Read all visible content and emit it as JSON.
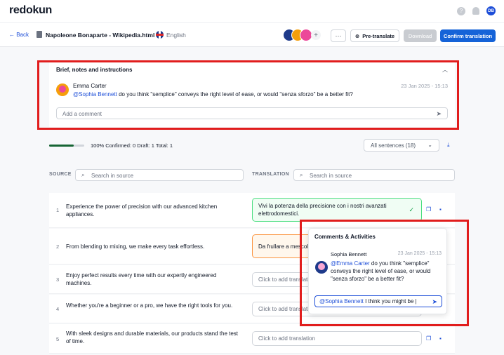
{
  "app": {
    "logo": "redokun",
    "user_initials": "DB",
    "help_glyph": "?"
  },
  "header": {
    "back_label": "← Back",
    "doc_title": "Napoleone Bonaparte - Wikipedia.html",
    "language": "English",
    "add_glyph": "+",
    "more_label": "···",
    "pretranslate_label": "Pre-translate",
    "download_label": "Download",
    "confirm_label": "Confirm translation"
  },
  "brief": {
    "title": "Brief, notes and instructions",
    "comment": {
      "author": "Emma Carter",
      "date": "23 Jan 2025 - 15:13",
      "mention": "@Sophia Bennett",
      "text": " do you think \"semplice\" conveys the right level of ease, or would \"senza sforzo\" be a better fit?"
    },
    "add_comment_placeholder": "Add a comment"
  },
  "progress": {
    "fraction": 0.7,
    "text": "100% Confirmed: 0  Draft: 1  Total: 1"
  },
  "filter": {
    "label": "All sentences (18)"
  },
  "columns": {
    "source_label": "SOURCE",
    "translation_label": "TRANSLATION",
    "source_search_placeholder": "Search in source",
    "translation_search_placeholder": "Search in source"
  },
  "rows": [
    {
      "num": "1",
      "source": "Experience the power of precision with our advanced kitchen appliances.",
      "translation": "Vivi la potenza della precisione con i nostri avanzati elettrodomestici."
    },
    {
      "num": "2",
      "source": "From blending to mixing, we make every task effortless.",
      "translation": "Da frullare a mescolare, rendiamo ogni compito semplice."
    },
    {
      "num": "3",
      "source": "Enjoy perfect results every time with our expertly engineered machines.",
      "translation": "Click to add translation"
    },
    {
      "num": "4",
      "source": "Whether you're a beginner or a pro, we have the right tools for you.",
      "translation": "Click to add translation"
    },
    {
      "num": "5",
      "source": "With sleek designs and durable materials, our products stand the test of time.",
      "translation": "Click to add translation"
    }
  ],
  "popup": {
    "title": "Comments & Activities",
    "author": "Sophia Bennett",
    "date": "23 Jan 2025 - 15:13",
    "mention": "@Emma Carter",
    "text": " do you think \"semplice\" conveys the right level of ease, or would \"senza sforzo\" be a better fit?",
    "input_mention": "@Sophia Bennett",
    "input_text": " I think you might be |"
  },
  "colors": {
    "accent": "#1563d8",
    "highlight_box": "#e11d1d",
    "confirmed_border": "#4ade80",
    "draft_border": "#fb923c",
    "progress_fill": "#166534"
  }
}
